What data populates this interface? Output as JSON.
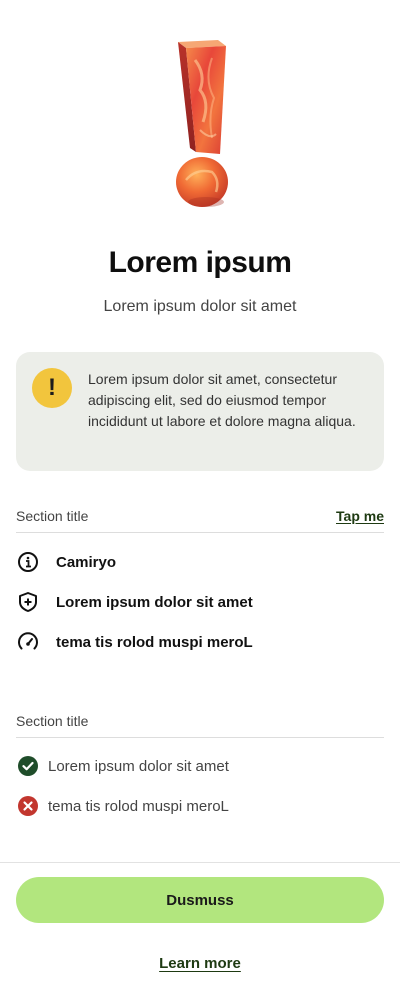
{
  "hero": {
    "icon": "exclamation-3d-illustration"
  },
  "header": {
    "title": "Lorem ipsum",
    "subtitle": "Lorem ipsum dolor sit amet"
  },
  "alert": {
    "icon": "exclamation-icon",
    "icon_glyph": "!",
    "text": "Lorem ipsum dolor sit amet, consectetur adipiscing elit, sed do eiusmod tempor incididunt ut labore et dolore magna aliqua.",
    "background": "#eceee9",
    "icon_color": "#f2c53d"
  },
  "section1": {
    "title": "Section title",
    "link": "Tap me",
    "items": [
      {
        "icon": "info-icon",
        "label": "Camiryo"
      },
      {
        "icon": "shield-plus-icon",
        "label": "Lorem ipsum dolor sit amet"
      },
      {
        "icon": "gauge-icon",
        "label": "tema tis rolod muspi meroL"
      }
    ]
  },
  "section2": {
    "title": "Section title",
    "items": [
      {
        "icon": "check-circle-icon",
        "status": "success",
        "color": "#1f4d2a",
        "label": "Lorem ipsum dolor sit amet"
      },
      {
        "icon": "x-circle-icon",
        "status": "error",
        "color": "#c2362e",
        "label": "tema tis rolod muspi meroL"
      }
    ]
  },
  "footer": {
    "primary_button": "Dusmuss",
    "primary_color": "#b2e67e",
    "link": "Learn more",
    "link_color": "#1e3a12"
  }
}
